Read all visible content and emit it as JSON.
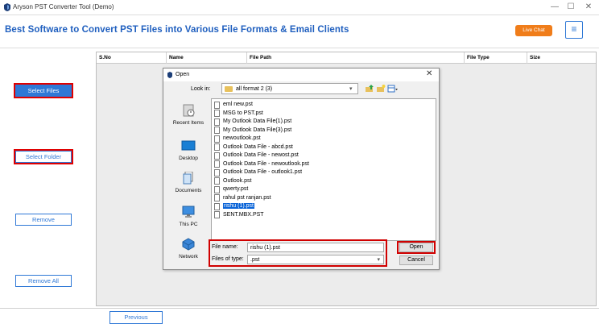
{
  "window": {
    "title": "Aryson PST Converter Tool (Demo)",
    "min_glyph": "—",
    "max_glyph": "☐",
    "close_glyph": "✕"
  },
  "header": {
    "title": "Best Software to Convert PST Files into Various File Formats & Email Clients",
    "live_chat_label": "Live Chat",
    "menu_glyph": "≡"
  },
  "sidebar": {
    "buttons": [
      {
        "label": "Select Files"
      },
      {
        "label": "Select Folder"
      },
      {
        "label": "Remove"
      },
      {
        "label": "Remove All"
      }
    ]
  },
  "table": {
    "columns": [
      "S.No",
      "Name",
      "File Path",
      "File Type",
      "Size"
    ]
  },
  "footer": {
    "previous_label": "Previous"
  },
  "dialog": {
    "title": "Open",
    "close_glyph": "✕",
    "look_in_label": "Look in:",
    "look_in_value": "all format 2 (3)",
    "places": [
      "Recent Items",
      "Desktop",
      "Documents",
      "This PC",
      "Network"
    ],
    "files": [
      "eml new.pst",
      "MSG to PST.pst",
      "My Outlook Data File(1).pst",
      "My Outlook Data File(3).pst",
      "newoutlook.pst",
      "Outlook Data File - abcd.pst",
      "Outlook Data File - newost.pst",
      "Outlook Data File - newoutlook.pst",
      "Outlook Data File - outlook1.pst",
      "Outlook.pst",
      "qwerty.pst",
      "rahul pst ranjan.pst",
      "rishu (1).pst",
      "SENT.MBX.PST"
    ],
    "selected_file": "rishu (1).pst",
    "file_name_label": "File name:",
    "file_name_value": "rishu (1).pst",
    "file_type_label": "Files of type:",
    "file_type_value": ".pst",
    "open_label": "Open",
    "cancel_label": "Cancel"
  },
  "colors": {
    "accent": "#2f78d6",
    "live_chat": "#f07d1a",
    "highlight_box": "#e00000",
    "selection": "#0a64d8"
  }
}
